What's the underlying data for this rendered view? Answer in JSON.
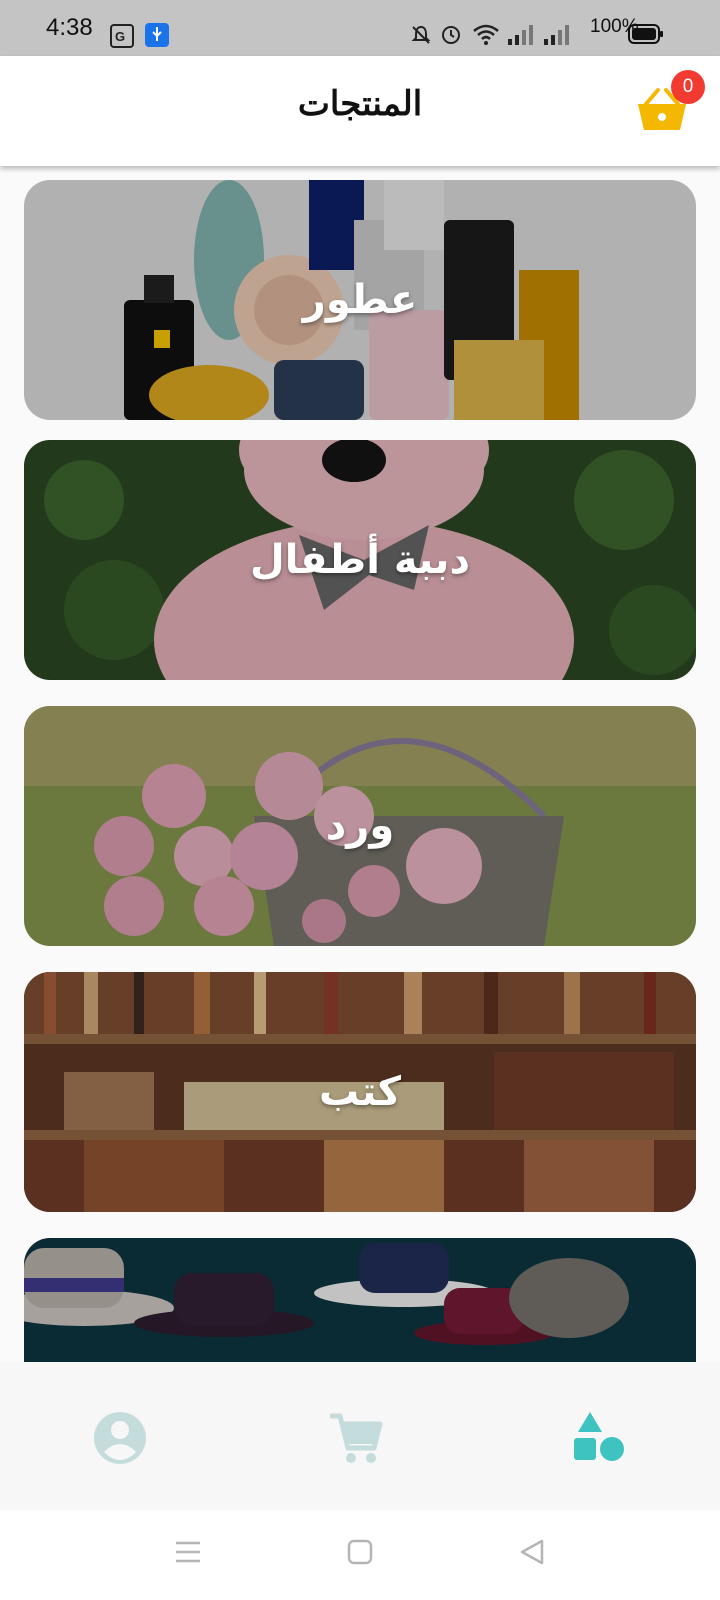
{
  "status_bar": {
    "time": "4:38",
    "battery_percent": "100%",
    "icons": [
      "translate-icon",
      "usb-icon",
      "mute-icon",
      "alarm-icon",
      "wifi-icon",
      "signal-icon",
      "signal-icon",
      "battery-icon"
    ]
  },
  "header": {
    "title": "المنتجات",
    "cart_count": "0",
    "cart_color": "#f5b800",
    "badge_color": "#f23b30"
  },
  "categories": [
    {
      "label": "عطور",
      "image": "perfume-bottles"
    },
    {
      "label": "دببة أطفال",
      "image": "pink-teddy-bear"
    },
    {
      "label": "ورد",
      "image": "roses-basket"
    },
    {
      "label": "كتب",
      "image": "bookshelves"
    },
    {
      "label": "",
      "image": "hats"
    }
  ],
  "bottom_nav": {
    "items": [
      {
        "icon": "account-icon",
        "active": false
      },
      {
        "icon": "cart-icon",
        "active": false
      },
      {
        "icon": "categories-icon",
        "active": true
      }
    ],
    "active_color": "#3fc3c0",
    "inactive_color": "#c5dcdc"
  },
  "system_nav": [
    "menu-icon",
    "home-icon",
    "back-icon"
  ]
}
